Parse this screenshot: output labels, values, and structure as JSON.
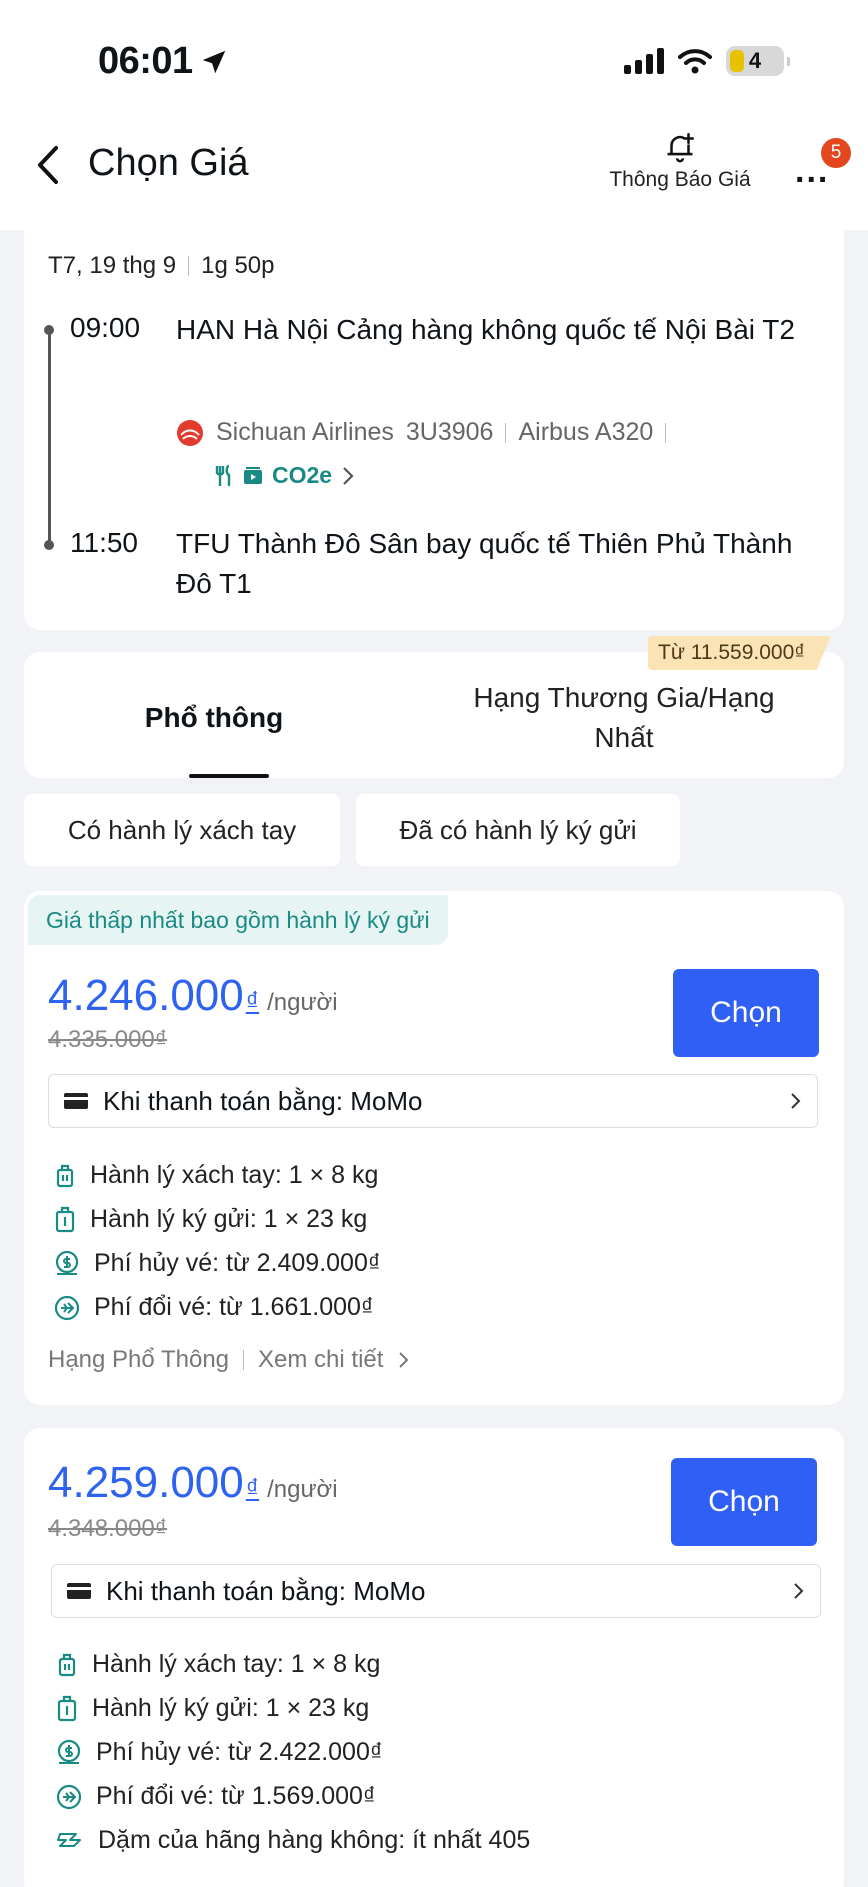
{
  "status": {
    "time": "06:01",
    "battery": "4"
  },
  "nav": {
    "title": "Chọn Giá",
    "bell_label": "Thông Báo Giá",
    "badge": "5",
    "more": "..."
  },
  "flight": {
    "date": "T7, 19 thg 9",
    "duration": "1g 50p",
    "depart_time": "09:00",
    "depart_airport": "HAN Hà Nội Cảng hàng không quốc tế Nội Bài T2",
    "airline": "Sichuan Airlines",
    "flight_no": "3U3906",
    "aircraft": "Airbus A320",
    "co2": "CO2e",
    "arrive_time": "11:50",
    "arrive_airport": "TFU Thành Đô Sân bay quốc tế Thiên Phủ Thành Đô T1"
  },
  "tabs": {
    "economy": "Phổ thông",
    "business": "Hạng Thương Gia/Hạng Nhất",
    "business_from": "Từ 11.559.000₫"
  },
  "filters": {
    "carry_on": "Có hành lý xách tay",
    "checked": "Đã có hành lý ký gửi"
  },
  "offers": [
    {
      "tag": "Giá thấp nhất bao gồm hành lý ký gửi",
      "price": "4.246.000",
      "currency": "₫",
      "per": "/người",
      "old_price": "4.335.000₫",
      "button": "Chọn",
      "payment": "Khi thanh toán bằng: MoMo",
      "carry_on": "Hành lý xách tay: 1 × 8 kg",
      "checked": "Hành lý ký gửi: 1 × 23 kg",
      "cancel_fee": "Phí hủy vé: từ 2.409.000₫",
      "change_fee": "Phí đổi vé: từ 1.661.000₫",
      "fare_class": "Hạng Phổ Thông",
      "details": "Xem chi tiết"
    },
    {
      "price": "4.259.000",
      "currency": "₫",
      "per": "/người",
      "old_price": "4.348.000₫",
      "button": "Chọn",
      "payment": "Khi thanh toán bằng: MoMo",
      "carry_on": "Hành lý xách tay: 1 × 8 kg",
      "checked": "Hành lý ký gửi: 1 × 23 kg",
      "cancel_fee": "Phí hủy vé: từ 2.422.000₫",
      "change_fee": "Phí đổi vé: từ 1.569.000₫",
      "miles": "Dặm của hãng hàng không: ít nhất 405"
    }
  ],
  "colors": {
    "accent": "#2f5ff5",
    "teal": "#1a8a84",
    "badge": "#e4471e"
  }
}
